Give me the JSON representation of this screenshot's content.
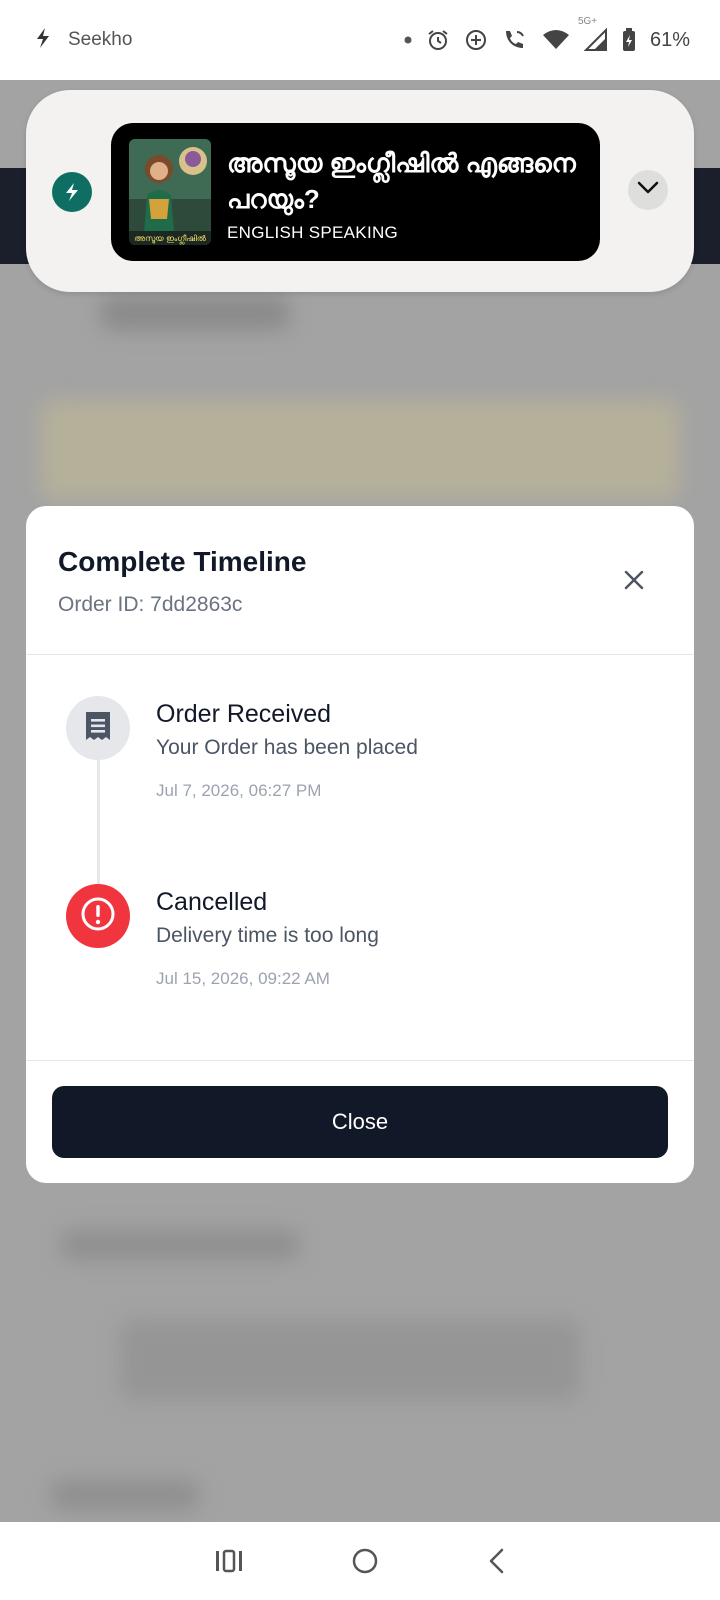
{
  "status_bar": {
    "app_name": "Seekho",
    "battery": "61%",
    "network_badge": "5G+",
    "icons": [
      "seekho-logo-icon",
      "dot-icon",
      "alarm-icon",
      "data-saver-icon",
      "wifi-call-icon",
      "wifi-icon",
      "signal-icon",
      "battery-icon"
    ]
  },
  "notification": {
    "title": "അസൂയ ഇംഗ്ലീഷിൽ എങ്ങനെ പറയും?",
    "subtitle": "ENGLISH SPEAKING",
    "thumb_caption": "അസൂയ ഇംഗ്ലീഷിൽ",
    "accent": "#0e6e63"
  },
  "modal": {
    "title": "Complete Timeline",
    "order_id": "Order ID: 7dd2863c",
    "timeline": [
      {
        "title": "Order Received",
        "description": "Your Order has been placed",
        "time": "Jul 7, 2026, 06:27 PM",
        "icon": "receipt-icon",
        "icon_bg": "#e5e7eb"
      },
      {
        "title": "Cancelled",
        "description": "Delivery time is too long",
        "time": "Jul 15, 2026, 09:22 AM",
        "icon": "alert-icon",
        "icon_bg": "#f0353f"
      }
    ],
    "close_label": "Close"
  },
  "colors": {
    "dark": "#111827",
    "danger": "#f0353f"
  }
}
